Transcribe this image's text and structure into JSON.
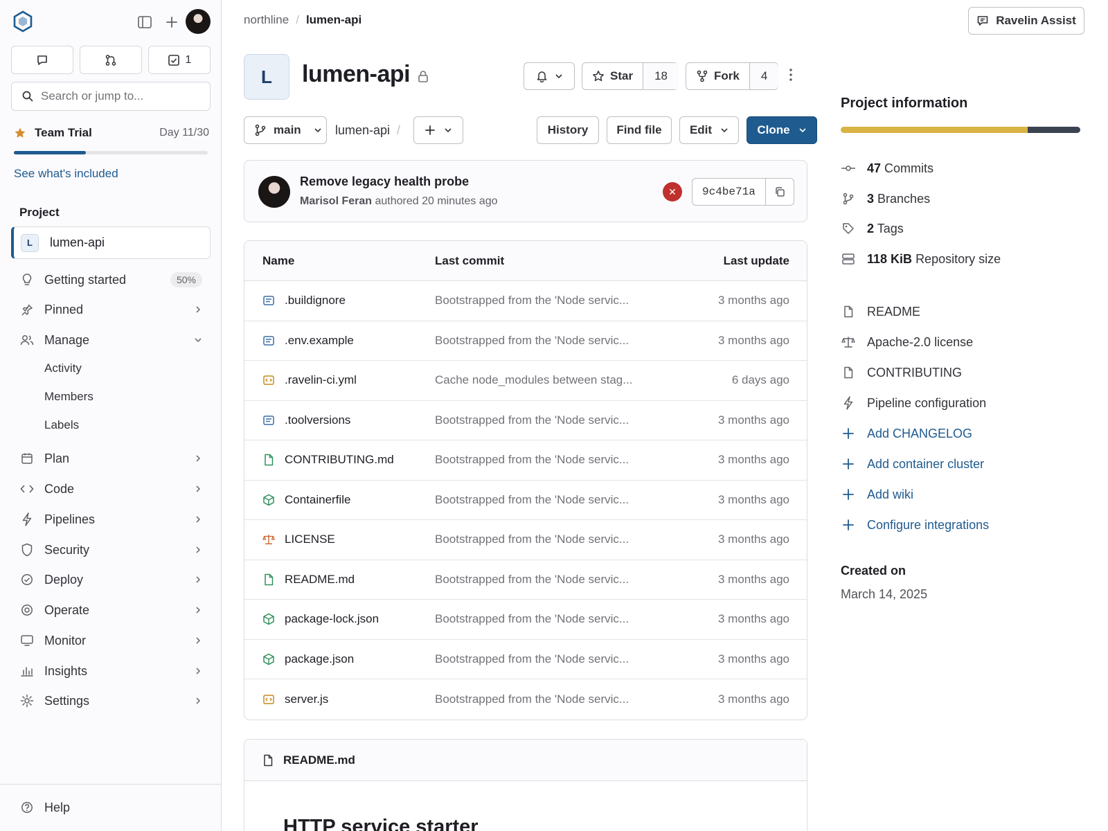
{
  "sidebar": {
    "todo_count": "1",
    "search_placeholder": "Search or jump to...",
    "trial": {
      "name": "Team Trial",
      "day": "Day 11/30",
      "progress": 0.37
    },
    "see_link": "See what's included",
    "section_label": "Project",
    "project": {
      "initial": "L",
      "name": "lumen-api"
    },
    "nav": {
      "getting_started": {
        "label": "Getting started",
        "badge": "50%"
      },
      "pinned": "Pinned",
      "manage": "Manage",
      "manage_sub": [
        "Activity",
        "Members",
        "Labels"
      ],
      "plan": "Plan",
      "code": "Code",
      "pipelines": "Pipelines",
      "security": "Security",
      "deploy": "Deploy",
      "operate": "Operate",
      "monitor": "Monitor",
      "insights": "Insights",
      "settings": "Settings"
    },
    "help": "Help"
  },
  "header": {
    "breadcrumb": {
      "group": "northline",
      "separator": "/",
      "project": "lumen-api"
    },
    "assist_label": "Ravelin Assist"
  },
  "project": {
    "initial": "L",
    "title": "lumen-api",
    "star_label": "Star",
    "star_count": "18",
    "fork_label": "Fork",
    "fork_count": "4"
  },
  "toolbar": {
    "branch": "main",
    "path": "lumen-api",
    "path_sep": "/",
    "history": "History",
    "find_file": "Find file",
    "edit": "Edit",
    "clone": "Clone"
  },
  "commit": {
    "title": "Remove legacy health probe",
    "author": "Marisol Feran",
    "meta": "authored 20 minutes ago",
    "sha": "9c4be71a",
    "status": "failed"
  },
  "files": {
    "headers": {
      "name": "Name",
      "last_commit": "Last commit",
      "last_update": "Last update"
    },
    "rows": [
      {
        "name": ".buildignore",
        "commit": "Bootstrapped from the 'Node servic...",
        "updated": "3 months ago",
        "icon": "text"
      },
      {
        "name": ".env.example",
        "commit": "Bootstrapped from the 'Node servic...",
        "updated": "3 months ago",
        "icon": "text"
      },
      {
        "name": ".ravelin-ci.yml",
        "commit": "Cache node_modules between stag...",
        "updated": "6 days ago",
        "icon": "code"
      },
      {
        "name": ".toolversions",
        "commit": "Bootstrapped from the 'Node servic...",
        "updated": "3 months ago",
        "icon": "text"
      },
      {
        "name": "CONTRIBUTING.md",
        "commit": "Bootstrapped from the 'Node servic...",
        "updated": "3 months ago",
        "icon": "doc"
      },
      {
        "name": "Containerfile",
        "commit": "Bootstrapped from the 'Node servic...",
        "updated": "3 months ago",
        "icon": "box"
      },
      {
        "name": "LICENSE",
        "commit": "Bootstrapped from the 'Node servic...",
        "updated": "3 months ago",
        "icon": "scale"
      },
      {
        "name": "README.md",
        "commit": "Bootstrapped from the 'Node servic...",
        "updated": "3 months ago",
        "icon": "doc"
      },
      {
        "name": "package-lock.json",
        "commit": "Bootstrapped from the 'Node servic...",
        "updated": "3 months ago",
        "icon": "box"
      },
      {
        "name": "package.json",
        "commit": "Bootstrapped from the 'Node servic...",
        "updated": "3 months ago",
        "icon": "box"
      },
      {
        "name": "server.js",
        "commit": "Bootstrapped from the 'Node servic...",
        "updated": "3 months ago",
        "icon": "code"
      }
    ]
  },
  "readme": {
    "filename": "README.md",
    "heading": "HTTP service starter"
  },
  "info": {
    "title": "Project information",
    "language_bar": [
      {
        "share": 0.78,
        "color": "#d9b344"
      },
      {
        "share": 0.22,
        "color": "#3b4351"
      }
    ],
    "stats": [
      {
        "value": "47",
        "label": "Commits"
      },
      {
        "value": "3",
        "label": "Branches"
      },
      {
        "value": "2",
        "label": "Tags"
      },
      {
        "value": "118 KiB",
        "label": "Repository size"
      }
    ],
    "docs": [
      "README",
      "Apache-2.0 license",
      "CONTRIBUTING",
      "Pipeline configuration"
    ],
    "actions": [
      "Add CHANGELOG",
      "Add container cluster",
      "Add wiki",
      "Configure integrations"
    ],
    "created_label": "Created on",
    "created_date": "March 14, 2025"
  },
  "colors": {
    "primary": "#1f5b8f",
    "danger": "#c0302d",
    "trial_star": "#d4902e"
  }
}
